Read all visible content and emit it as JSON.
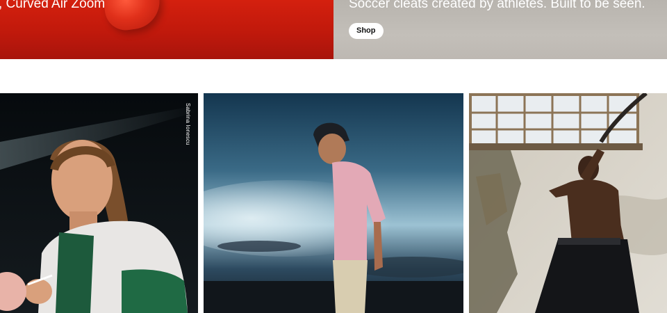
{
  "hero": {
    "left": {
      "headline": ", Curved Air Zoom",
      "background_color": "#c41b0d"
    },
    "right": {
      "subhead": "Soccer cleats created by athletes. Built to be seen.",
      "shop_label": "Shop",
      "background_color": "#bfbbb5"
    }
  },
  "cards": [
    {
      "caption": "Sabrina Ionescu",
      "image": "athlete-portrait-green-white-jacket"
    },
    {
      "image": "man-pink-polo-cap-under-cloudy-sky"
    },
    {
      "image": "athlete-battle-rope-workout-industrial-room"
    }
  ]
}
